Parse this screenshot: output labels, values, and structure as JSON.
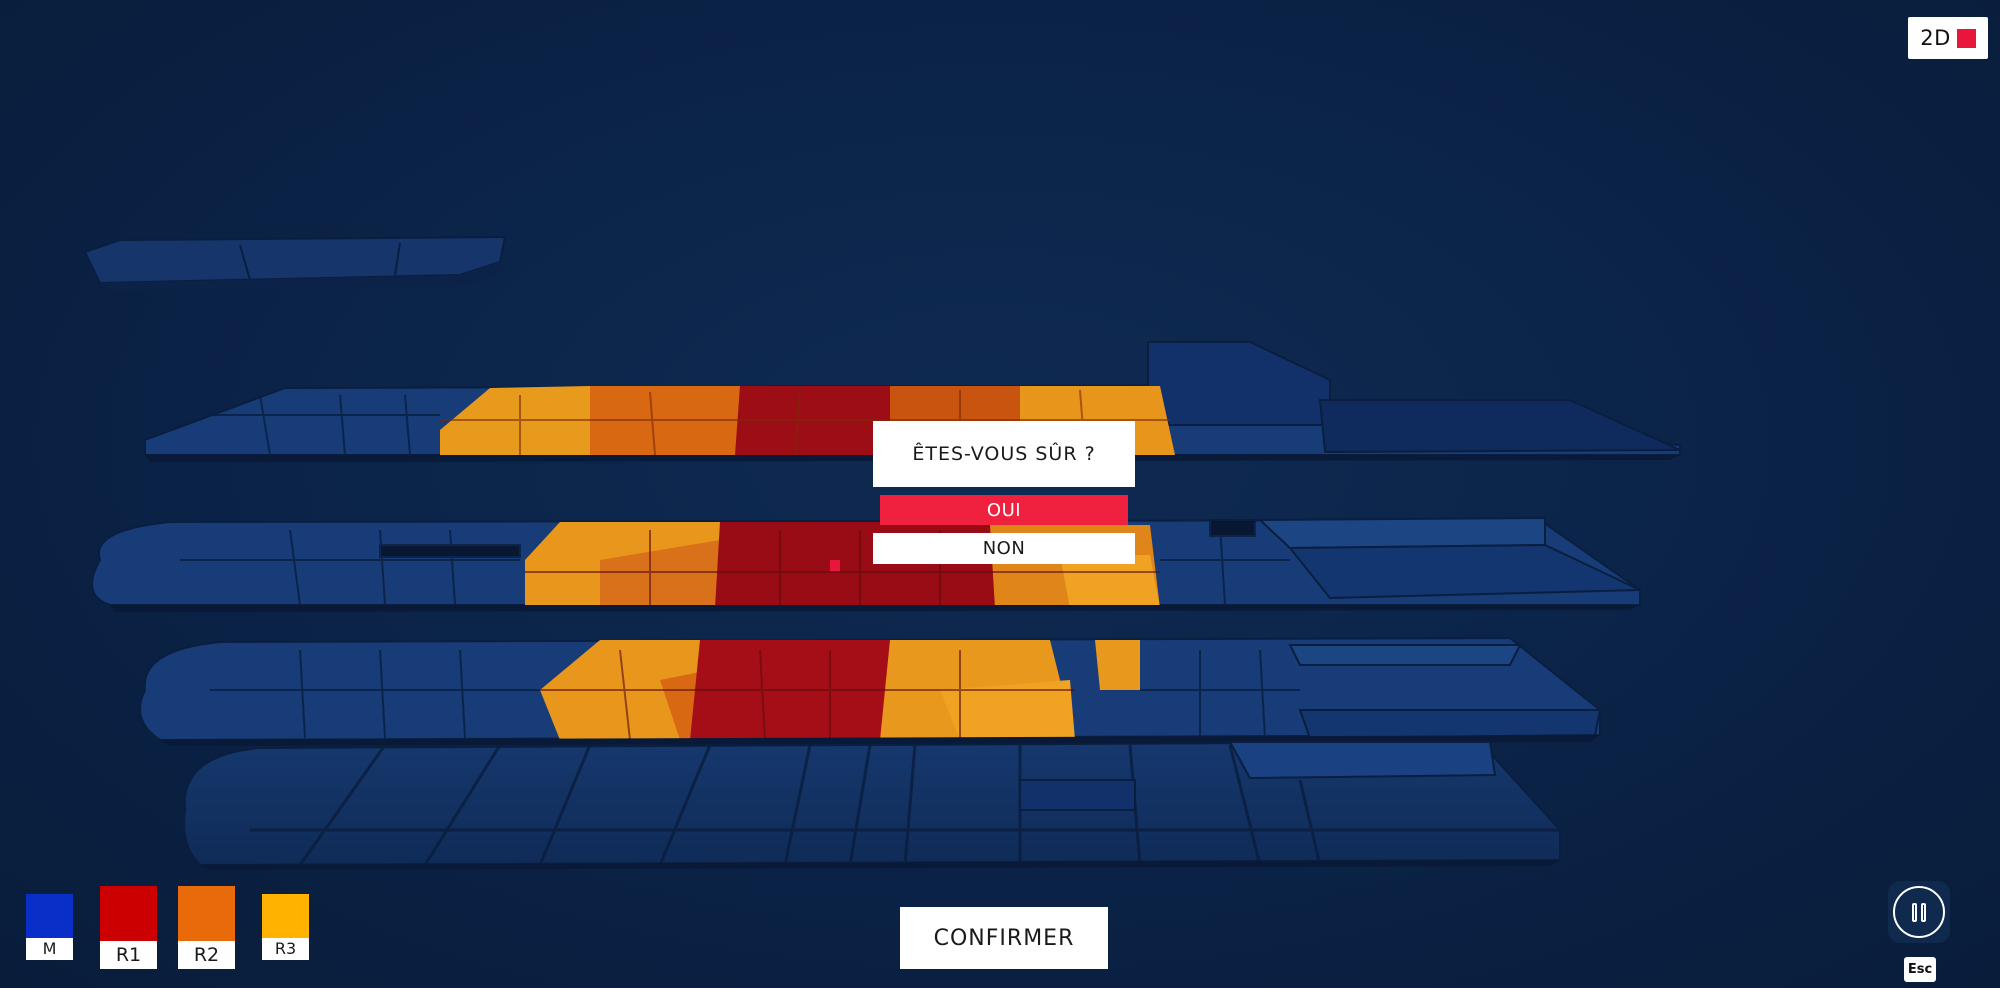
{
  "view_toggle": {
    "label": "2D",
    "indicator_color": "#e8163a"
  },
  "dialog": {
    "title": "ÊTES-VOUS SÛR ?",
    "yes_label": "OUI",
    "no_label": "NON",
    "yes_color": "#f0203f"
  },
  "confirm_label": "CONFIRMER",
  "legend": [
    {
      "label": "M",
      "color": "#0a2fc9"
    },
    {
      "label": "R1",
      "color": "#cc0000"
    },
    {
      "label": "R2",
      "color": "#e86a0a"
    },
    {
      "label": "R3",
      "color": "#ffb300"
    }
  ],
  "controls": {
    "pause_icon": "pause-icon",
    "esc_label": "Esc"
  }
}
